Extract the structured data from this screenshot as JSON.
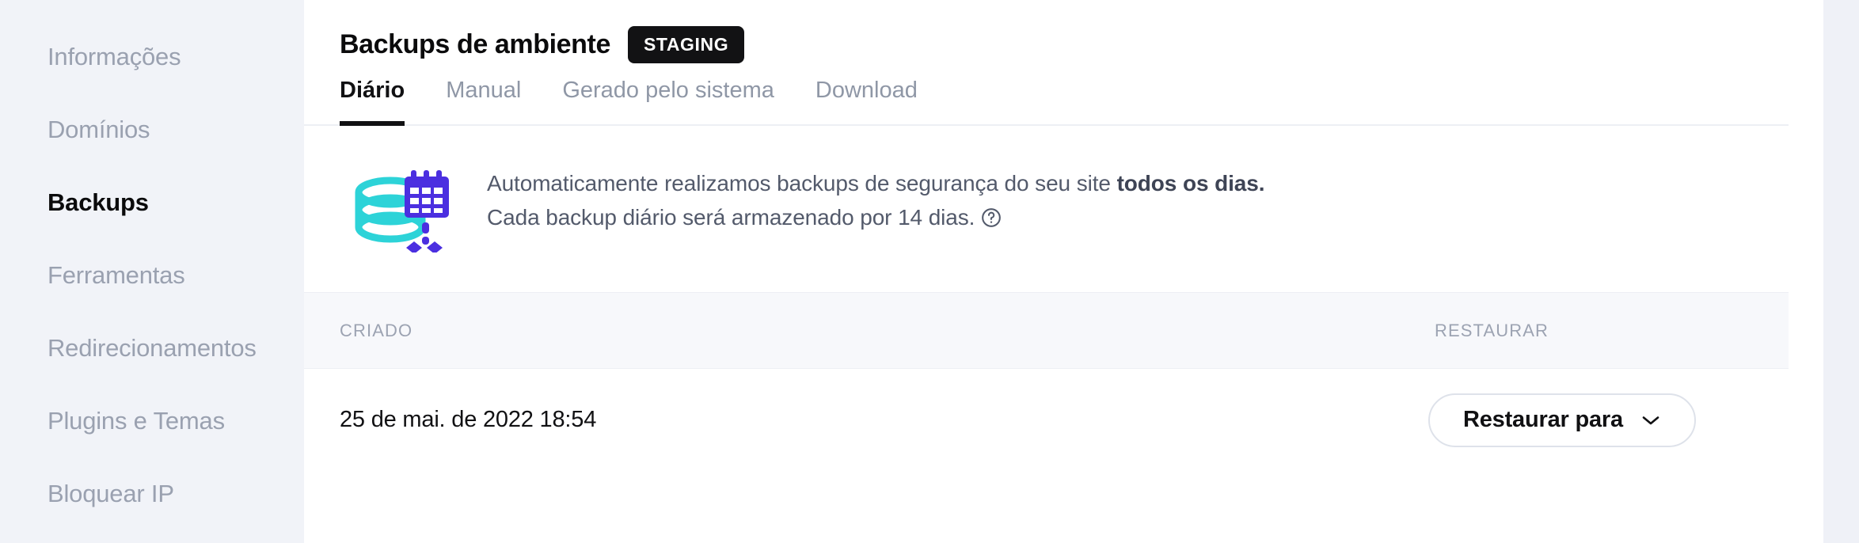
{
  "sidebar": {
    "items": [
      {
        "label": "Informações",
        "active": false
      },
      {
        "label": "Domínios",
        "active": false
      },
      {
        "label": "Backups",
        "active": true
      },
      {
        "label": "Ferramentas",
        "active": false
      },
      {
        "label": "Redirecionamentos",
        "active": false
      },
      {
        "label": "Plugins e Temas",
        "active": false
      },
      {
        "label": "Bloquear IP",
        "active": false
      }
    ]
  },
  "header": {
    "title": "Backups de ambiente",
    "environment_badge": "STAGING"
  },
  "tabs": [
    {
      "label": "Diário",
      "active": true
    },
    {
      "label": "Manual",
      "active": false
    },
    {
      "label": "Gerado pelo sistema",
      "active": false
    },
    {
      "label": "Download",
      "active": false
    }
  ],
  "info": {
    "line1_prefix": "Automaticamente realizamos backups de segurança do seu site ",
    "line1_strong": "todos os dias.",
    "line2": "Cada backup diário será armazenado por 14 dias.",
    "help_icon": "question-mark-circle-icon",
    "illustration_icon": "database-calendar-backup-icon"
  },
  "table": {
    "columns": [
      {
        "key": "created",
        "label": "CRIADO"
      },
      {
        "key": "restore",
        "label": "RESTAURAR"
      }
    ],
    "rows": [
      {
        "created": "25 de mai. de 2022 18:54",
        "restore_button": "Restaurar para",
        "restore_icon": "chevron-down-icon"
      }
    ]
  },
  "colors": {
    "sidebar_background": "#F1F3F8",
    "sidebar_text": "#9AA1B0",
    "sidebar_active_text": "#0B0B0C",
    "badge_background": "#121214",
    "badge_text": "#FFFFFF",
    "tab_active": "#111113",
    "tab_inactive": "#8F97A6",
    "info_text": "#535A6B",
    "table_header_background": "#F7F8FB",
    "table_header_text": "#9CA3B2",
    "border": "#EDEFF4",
    "button_border": "#DEE2EA",
    "illustration_cyan": "#2DD3D8",
    "illustration_purple": "#4B2FE0"
  }
}
